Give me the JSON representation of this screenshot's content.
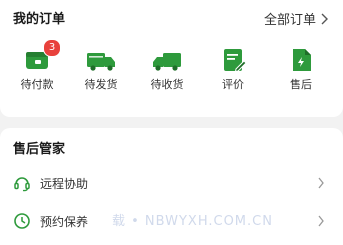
{
  "orders": {
    "title": "我的订单",
    "all_label": "全部订单",
    "items": [
      {
        "label": "待付款",
        "icon": "wallet-icon",
        "badge": "3"
      },
      {
        "label": "待发货",
        "icon": "delivery-truck-icon"
      },
      {
        "label": "待收货",
        "icon": "receive-truck-icon"
      },
      {
        "label": "评价",
        "icon": "review-pencil-icon"
      },
      {
        "label": "售后",
        "icon": "after-sales-document-icon"
      }
    ]
  },
  "service": {
    "title": "售后管家",
    "items": [
      {
        "label": "远程协助",
        "icon": "headset-icon"
      },
      {
        "label": "预约保养",
        "icon": "clock-icon"
      }
    ]
  },
  "watermark": "载 • NBWYXH.COM.CN",
  "colors": {
    "accent_green": "#2e9a3c",
    "badge_red": "#e8413c"
  }
}
